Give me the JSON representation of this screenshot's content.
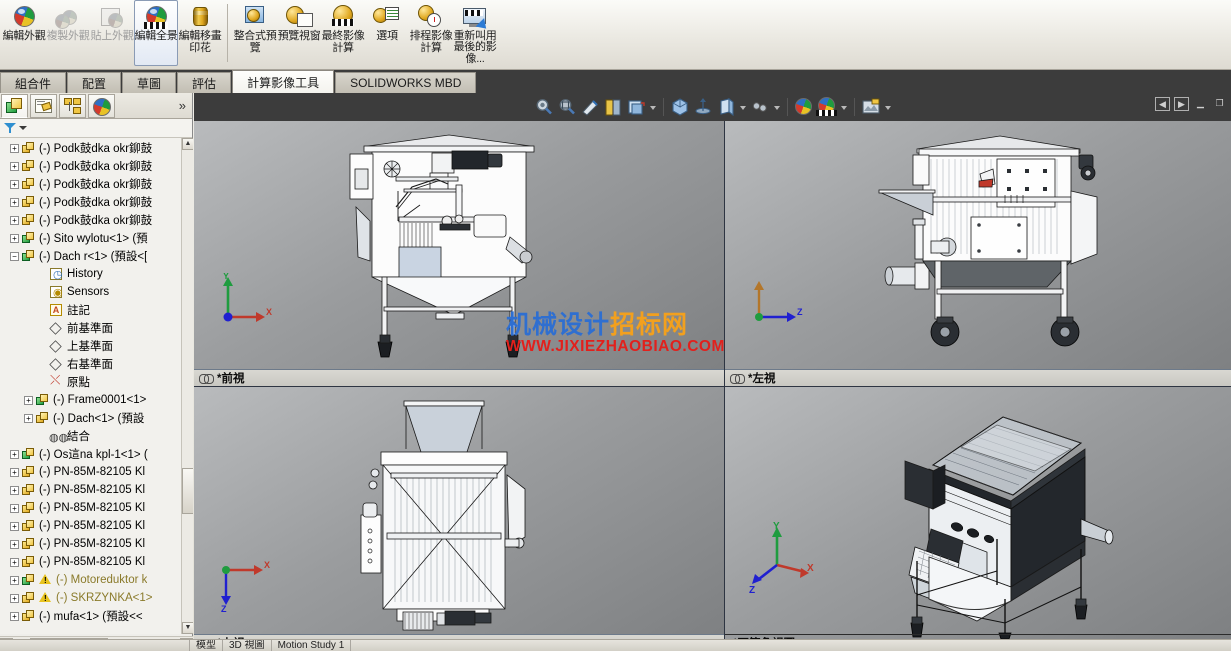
{
  "app": {
    "title": "SOLIDWORKS"
  },
  "ribbon": {
    "buttons": [
      {
        "label": "編輯外觀",
        "icon": "edit-appearance-icon",
        "state": "normal"
      },
      {
        "label": "複製外觀",
        "icon": "copy-appearance-icon",
        "state": "disabled"
      },
      {
        "label": "貼上外觀",
        "icon": "paste-appearance-icon",
        "state": "disabled"
      },
      {
        "label": "編輯全景",
        "icon": "edit-scene-icon",
        "state": "selected"
      },
      {
        "label": "編輯移畫印花",
        "icon": "edit-decal-icon",
        "state": "normal"
      },
      {
        "label": "整合式預覽",
        "icon": "integrated-preview-icon",
        "state": "normal"
      },
      {
        "label": "預覽視窗",
        "icon": "preview-window-icon",
        "state": "normal"
      },
      {
        "label": "最終影像計算",
        "icon": "final-render-icon",
        "state": "normal"
      },
      {
        "label": "選項",
        "icon": "options-icon",
        "state": "normal"
      },
      {
        "label": "排程影像計算",
        "icon": "schedule-render-icon",
        "state": "normal"
      },
      {
        "label": "重新叫用最後的影像...",
        "icon": "recall-last-render-icon",
        "state": "normal"
      }
    ]
  },
  "command_tabs": {
    "items": [
      {
        "label": "組合件",
        "active": false
      },
      {
        "label": "配置",
        "active": false
      },
      {
        "label": "草圖",
        "active": false
      },
      {
        "label": "評估",
        "active": false
      },
      {
        "label": "計算影像工具",
        "active": true
      },
      {
        "label": "SOLIDWORKS MBD",
        "active": false
      }
    ]
  },
  "left_panel": {
    "tabs": [
      {
        "name": "feature-manager-tab",
        "active": true
      },
      {
        "name": "property-manager-tab",
        "active": false
      },
      {
        "name": "configuration-manager-tab",
        "active": false
      },
      {
        "name": "display-manager-tab",
        "active": false
      }
    ],
    "expand_label": "»",
    "filter_placeholder": "",
    "tree": [
      {
        "label": "(-) Podk鼓dka okr鉚鼓",
        "icon": "part-icon",
        "indent": 1,
        "expandable": true,
        "warn": false
      },
      {
        "label": "(-) Podk鼓dka okr鉚鼓",
        "icon": "part-icon",
        "indent": 1,
        "expandable": true,
        "warn": false
      },
      {
        "label": "(-) Podk鼓dka okr鉚鼓",
        "icon": "part-icon",
        "indent": 1,
        "expandable": true,
        "warn": false
      },
      {
        "label": "(-) Podk鼓dka okr鉚鼓",
        "icon": "part-icon",
        "indent": 1,
        "expandable": true,
        "warn": false
      },
      {
        "label": "(-) Podk鼓dka okr鉚鼓",
        "icon": "part-icon",
        "indent": 1,
        "expandable": true,
        "warn": false
      },
      {
        "label": "(-) Sito wylotu<1> (預",
        "icon": "assembly-icon",
        "indent": 1,
        "expandable": true,
        "warn": false
      },
      {
        "label": "(-) Dach r<1> (預設<[",
        "icon": "assembly-icon",
        "indent": 1,
        "expandable": true,
        "expanded": true,
        "warn": false
      },
      {
        "label": "History",
        "icon": "history-icon",
        "indent": 3,
        "expandable": false,
        "warn": false
      },
      {
        "label": "Sensors",
        "icon": "sensors-icon",
        "indent": 3,
        "expandable": false,
        "warn": false
      },
      {
        "label": "註記",
        "icon": "annotations-icon",
        "indent": 3,
        "expandable": false,
        "warn": false
      },
      {
        "label": "前基準面",
        "icon": "plane-icon",
        "indent": 3,
        "expandable": false,
        "warn": false
      },
      {
        "label": "上基準面",
        "icon": "plane-icon",
        "indent": 3,
        "expandable": false,
        "warn": false
      },
      {
        "label": "右基準面",
        "icon": "plane-icon",
        "indent": 3,
        "expandable": false,
        "warn": false
      },
      {
        "label": "原點",
        "icon": "origin-icon",
        "indent": 3,
        "expandable": false,
        "warn": false
      },
      {
        "label": "(-) Frame0001<1>",
        "icon": "assembly-icon",
        "indent": 2,
        "expandable": true,
        "warn": false
      },
      {
        "label": "(-) Dach<1> (預設",
        "icon": "part-icon",
        "indent": 2,
        "expandable": true,
        "warn": false
      },
      {
        "label": "結合",
        "icon": "mates-icon",
        "indent": 3,
        "expandable": false,
        "warn": false
      },
      {
        "label": "(-) Os這na kpl-1<1> (",
        "icon": "assembly-icon",
        "indent": 1,
        "expandable": true,
        "warn": false
      },
      {
        "label": "(-) PN-85M-82105 Kl",
        "icon": "part-icon",
        "indent": 1,
        "expandable": true,
        "warn": false
      },
      {
        "label": "(-) PN-85M-82105 Kl",
        "icon": "part-icon",
        "indent": 1,
        "expandable": true,
        "warn": false
      },
      {
        "label": "(-) PN-85M-82105 Kl",
        "icon": "part-icon",
        "indent": 1,
        "expandable": true,
        "warn": false
      },
      {
        "label": "(-) PN-85M-82105 Kl",
        "icon": "part-icon",
        "indent": 1,
        "expandable": true,
        "warn": false
      },
      {
        "label": "(-) PN-85M-82105 Kl",
        "icon": "part-icon",
        "indent": 1,
        "expandable": true,
        "warn": false
      },
      {
        "label": "(-) PN-85M-82105 Kl",
        "icon": "part-icon",
        "indent": 1,
        "expandable": true,
        "warn": false
      },
      {
        "label": "(-) Motoreduktor k",
        "icon": "assembly-icon",
        "indent": 1,
        "expandable": true,
        "warn": true
      },
      {
        "label": "(-) SKRZYNKA<1>",
        "icon": "part-icon",
        "indent": 1,
        "expandable": true,
        "warn": true
      },
      {
        "label": "(-) mufa<1> (預設<<",
        "icon": "part-icon",
        "indent": 1,
        "expandable": true,
        "warn": false
      }
    ]
  },
  "view_toolbar": {
    "tools": [
      {
        "name": "zoom-to-fit-icon"
      },
      {
        "name": "zoom-to-area-icon"
      },
      {
        "name": "section-view-icon"
      },
      {
        "name": "measure-icon"
      },
      {
        "name": "view-orientation-icon",
        "caret": true
      },
      {
        "name": "display-style-icon"
      },
      {
        "name": "hide-show-items-icon"
      },
      {
        "name": "edit-appearance-icon",
        "caret": true
      },
      {
        "name": "apply-scene-icon",
        "caret": true
      },
      {
        "name": "view-settings-icon",
        "caret": true
      },
      {
        "name": "render-tools-icon",
        "caret": true
      }
    ]
  },
  "window_controls": {
    "buttons": [
      {
        "name": "tile-previous-button",
        "glyph": "◀"
      },
      {
        "name": "tile-next-button",
        "glyph": "▶"
      },
      {
        "name": "minimize-button",
        "glyph": "▁"
      },
      {
        "name": "restore-button",
        "glyph": "❐"
      }
    ]
  },
  "viewports": [
    {
      "id": "front",
      "label": "*前視",
      "linked": true,
      "triad": "xy"
    },
    {
      "id": "left",
      "label": "*左視",
      "linked": true,
      "triad": "zy"
    },
    {
      "id": "top",
      "label": "*上視",
      "linked": true,
      "triad": "xz"
    },
    {
      "id": "isometric",
      "label": "*不等角視圖",
      "linked": false,
      "triad": "iso"
    }
  ],
  "watermark": {
    "line1_blue": "机械设计",
    "line1_orange": "招标网",
    "line2": "WWW.JIXIEZHAOBIAO.COM",
    "color_blue": "#2f6fd0",
    "color_orange": "#f2a01e",
    "color_red": "#e2201c"
  },
  "status_bar": {
    "cells": [
      "模型",
      "3D 視圖",
      "Motion Study 1"
    ]
  },
  "colors": {
    "viewport_bg_light": "#b9bbbd",
    "viewport_bg_dark": "#7d7f81",
    "axis_x": "#c0392b",
    "axis_y": "#1f9c3f",
    "axis_z": "#2020d0",
    "tab_active_bg": "#fefefc",
    "ribbon_bg": "#ebe9e2"
  }
}
